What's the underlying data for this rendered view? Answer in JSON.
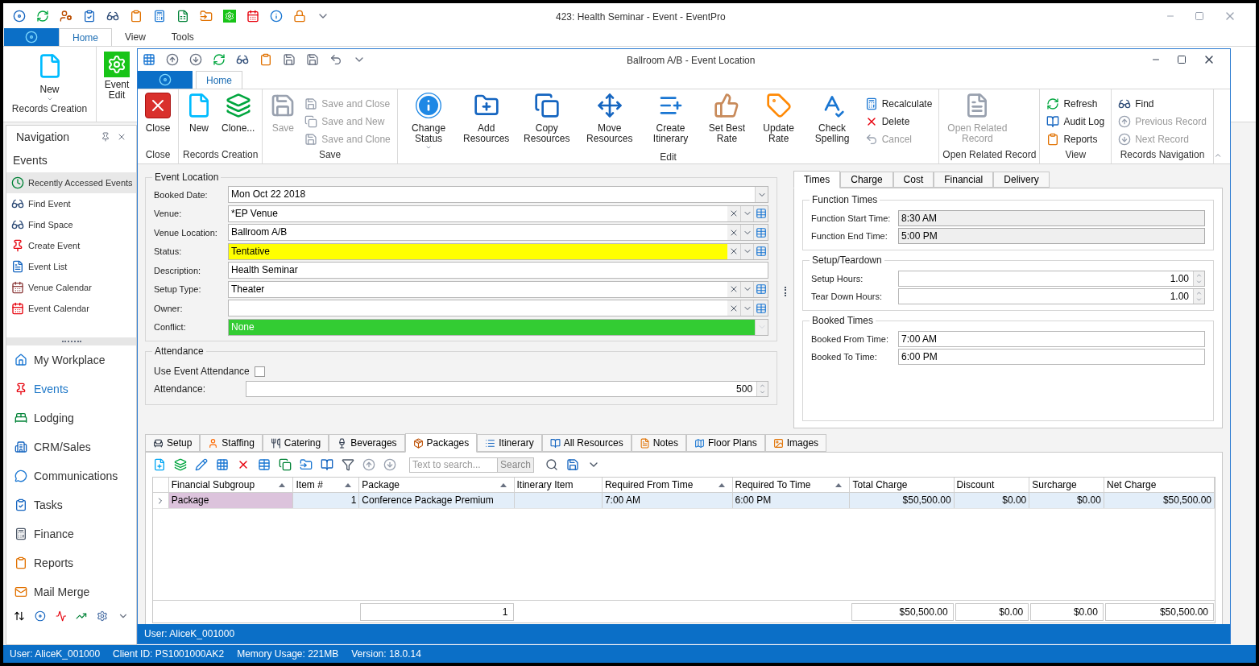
{
  "outer_window": {
    "title": "423: Health Seminar - Event - EventPro",
    "tabs": [
      {
        "label": "Home",
        "selected": true
      },
      {
        "label": "View",
        "selected": false
      },
      {
        "label": "Tools",
        "selected": false
      }
    ],
    "ribbon_buttons": [
      {
        "label": "New",
        "kind": "dropdown"
      },
      {
        "label": "Event Edit",
        "kind": "plain"
      }
    ],
    "ribbon_group": "Records Creation"
  },
  "navigation": {
    "title": "Navigation",
    "section": "Events",
    "items": [
      {
        "label": "Recently Accessed Events",
        "selected": true
      },
      {
        "label": "Find Event",
        "selected": false
      },
      {
        "label": "Find Space",
        "selected": false
      },
      {
        "label": "Create Event",
        "selected": false
      },
      {
        "label": "Event List",
        "selected": false
      },
      {
        "label": "Venue Calendar",
        "selected": false
      },
      {
        "label": "Event Calendar",
        "selected": false
      }
    ],
    "modules": [
      {
        "label": "My Workplace",
        "selected": false
      },
      {
        "label": "Events",
        "selected": true
      },
      {
        "label": "Lodging",
        "selected": false
      },
      {
        "label": "CRM/Sales",
        "selected": false
      },
      {
        "label": "Communications",
        "selected": false
      },
      {
        "label": "Tasks",
        "selected": false
      },
      {
        "label": "Finance",
        "selected": false
      },
      {
        "label": "Reports",
        "selected": false
      },
      {
        "label": "Mail Merge",
        "selected": false
      }
    ]
  },
  "event_window": {
    "title": "Ballroom A/B - Event Location",
    "tabs": [
      {
        "label": "Home",
        "selected": true
      }
    ],
    "ribbon_groups": [
      {
        "label": "Close",
        "items": [
          {
            "kind": "large",
            "label": "Close",
            "disabled": false
          }
        ]
      },
      {
        "label": "Records Creation",
        "items": [
          {
            "kind": "large",
            "label": "New",
            "disabled": false
          },
          {
            "kind": "large",
            "label": "Clone...",
            "disabled": false
          }
        ]
      },
      {
        "label": "Save",
        "items": [
          {
            "kind": "large",
            "label": "Save",
            "disabled": true
          },
          {
            "kind": "small",
            "label": "Save and Close",
            "disabled": true
          },
          {
            "kind": "small",
            "label": "Save and New",
            "disabled": true
          },
          {
            "kind": "small",
            "label": "Save and Clone",
            "disabled": true
          }
        ]
      },
      {
        "label": "Edit",
        "items": [
          {
            "kind": "large",
            "label": "Change Status",
            "disabled": false,
            "dropdown": true
          },
          {
            "kind": "large",
            "label": "Add Resources",
            "disabled": false
          },
          {
            "kind": "large",
            "label": "Copy Resources",
            "disabled": false
          },
          {
            "kind": "large",
            "label": "Move Resources",
            "disabled": false
          },
          {
            "kind": "large",
            "label": "Create Itinerary",
            "disabled": false
          },
          {
            "kind": "large",
            "label": "Set Best Rate",
            "disabled": false
          },
          {
            "kind": "large",
            "label": "Update Rate",
            "disabled": false
          },
          {
            "kind": "large",
            "label": "Check Spelling",
            "disabled": false
          },
          {
            "kind": "small",
            "label": "Recalculate",
            "disabled": false
          },
          {
            "kind": "small",
            "label": "Delete",
            "disabled": false
          },
          {
            "kind": "small",
            "label": "Cancel",
            "disabled": true
          }
        ]
      },
      {
        "label": "Open Related Record",
        "items": [
          {
            "kind": "large",
            "label": "Open Related Record",
            "disabled": true
          }
        ]
      },
      {
        "label": "View",
        "items": [
          {
            "kind": "small",
            "label": "Refresh",
            "disabled": false
          },
          {
            "kind": "small",
            "label": "Audit Log",
            "disabled": false
          },
          {
            "kind": "small",
            "label": "Reports",
            "disabled": false
          }
        ]
      },
      {
        "label": "Records Navigation",
        "items": [
          {
            "kind": "small",
            "label": "Find",
            "disabled": false
          },
          {
            "kind": "small",
            "label": "Previous Record",
            "disabled": true
          },
          {
            "kind": "small",
            "label": "Next Record",
            "disabled": true
          }
        ]
      }
    ],
    "event_location": {
      "title": "Event Location",
      "fields": [
        {
          "label": "Booked Date:",
          "value": "Mon Oct 22 2018",
          "kind": "date"
        },
        {
          "label": "Venue:",
          "value": "*EP Venue",
          "kind": "lookup"
        },
        {
          "label": "Venue Location:",
          "value": "Ballroom A/B",
          "kind": "lookup"
        },
        {
          "label": "Status:",
          "value": "Tentative",
          "kind": "lookup",
          "color": "#ffff00"
        },
        {
          "label": "Description:",
          "value": "Health Seminar",
          "kind": "text"
        },
        {
          "label": "Setup Type:",
          "value": "Theater",
          "kind": "lookup"
        },
        {
          "label": "Owner:",
          "kind": "lookup"
        },
        {
          "label": "Conflict:",
          "value": "None",
          "kind": "select",
          "disabled": true,
          "color": "#33cc33"
        }
      ]
    },
    "attendance": {
      "title": "Attendance",
      "checkbox": {
        "label": "Use Event Attendance",
        "checked": false
      },
      "field": {
        "label": "Attendance:",
        "value": "500"
      }
    },
    "detail_tabs": [
      {
        "label": "Times",
        "selected": true
      },
      {
        "label": "Charge",
        "selected": false
      },
      {
        "label": "Cost",
        "selected": false
      },
      {
        "label": "Financial",
        "selected": false
      },
      {
        "label": "Delivery",
        "selected": false
      }
    ],
    "detail_groups": [
      {
        "title": "Function Times",
        "fields": [
          {
            "label": "Function Start Time:",
            "value": "8:30 AM",
            "kind": "readonly"
          },
          {
            "label": "Function End Time:",
            "value": "5:00 PM",
            "kind": "readonly"
          }
        ]
      },
      {
        "title": "Setup/Teardown",
        "fields": [
          {
            "label": "Setup Hours:",
            "value": "1.00",
            "kind": "spin"
          },
          {
            "label": "Tear Down Hours:",
            "value": "1.00",
            "kind": "spin"
          }
        ]
      },
      {
        "title": "Booked Times",
        "fields": [
          {
            "label": "Booked From Time:",
            "value": "7:00 AM",
            "kind": "text"
          },
          {
            "label": "Booked To Time:",
            "value": "6:00 PM",
            "kind": "text"
          }
        ]
      }
    ],
    "grid_tabs": [
      {
        "label": "Setup",
        "selected": false
      },
      {
        "label": "Staffing",
        "selected": false
      },
      {
        "label": "Catering",
        "selected": false
      },
      {
        "label": "Beverages",
        "selected": false
      },
      {
        "label": "Packages",
        "selected": true
      },
      {
        "label": "Itinerary",
        "selected": false
      },
      {
        "label": "All Resources",
        "selected": false
      },
      {
        "label": "Notes",
        "selected": false
      },
      {
        "label": "Floor Plans",
        "selected": false
      },
      {
        "label": "Images",
        "selected": false
      }
    ],
    "search": {
      "placeholder": "Text to search...",
      "button": "Search"
    },
    "grid": {
      "columns": [
        {
          "label": "Financial Subgroup",
          "sorted": true
        },
        {
          "label": "Item #",
          "sorted": true
        },
        {
          "label": "Package",
          "sorted": true
        },
        {
          "label": "Itinerary Item",
          "sorted": false
        },
        {
          "label": "Required From Time",
          "sorted": true
        },
        {
          "label": "Required To Time",
          "sorted": true
        },
        {
          "label": "Total Charge",
          "sorted": false
        },
        {
          "label": "Discount",
          "sorted": false
        },
        {
          "label": "Surcharge",
          "sorted": false
        },
        {
          "label": "Net Charge",
          "sorted": false
        }
      ],
      "rows": [
        {
          "selected": true,
          "cells": {
            "financial_subgroup": "Package",
            "item_no": "1",
            "package": "Conference Package Premium",
            "required_from_time": "7:00 AM",
            "required_to_time": "6:00 PM",
            "total_charge": "$50,500.00",
            "discount": "$0.00",
            "surcharge": "$0.00",
            "net_charge": "$50,500.00"
          }
        }
      ],
      "footer": {
        "package": "1",
        "total_charge": "$50,500.00",
        "discount": "$0.00",
        "surcharge": "$0.00",
        "net_charge": "$50,500.00"
      }
    },
    "status": "User: AliceK_001000"
  },
  "status_bar": [
    "User: AliceK_001000",
    "Client ID: PS1001000AK2",
    "Memory Usage: 221MB",
    "Version: 18.0.14"
  ]
}
